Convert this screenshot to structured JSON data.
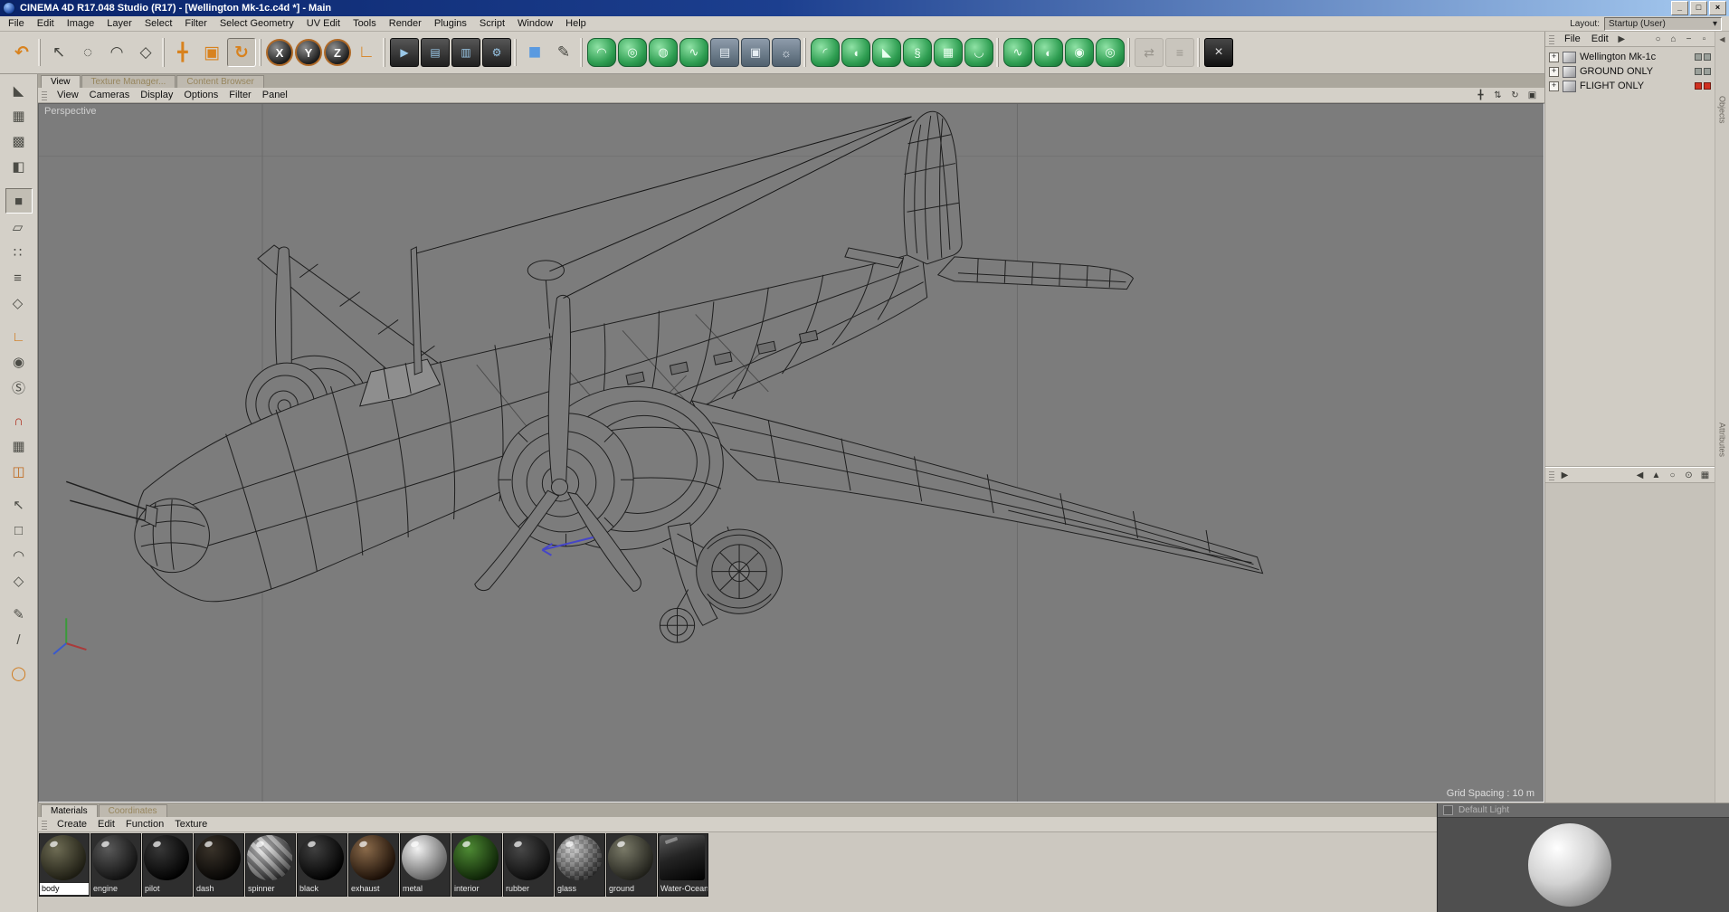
{
  "window": {
    "title": "CINEMA 4D R17.048 Studio (R17) - [Wellington Mk-1c.c4d *] - Main",
    "controls": [
      {
        "name": "minimize-button",
        "glyph": "_"
      },
      {
        "name": "maximize-button",
        "glyph": "□"
      },
      {
        "name": "close-button",
        "glyph": "×"
      }
    ]
  },
  "menubar": {
    "items": [
      "File",
      "Edit",
      "Image",
      "Layer",
      "Select",
      "Filter",
      "Select Geometry",
      "UV Edit",
      "Tools",
      "Render",
      "Plugins",
      "Script",
      "Window",
      "Help"
    ],
    "layout_label": "Layout:",
    "layout_value": "Startup (User)",
    "layout_arrow": "▾"
  },
  "toolbar": {
    "groups": [
      {
        "icons": [
          {
            "name": "undo-icon",
            "glyph": "↶",
            "kind": "orange"
          }
        ]
      },
      {
        "icons": [
          {
            "name": "selection-tool-icon",
            "glyph": "↖",
            "kind": "plain"
          },
          {
            "name": "live-selection-icon",
            "glyph": "◌",
            "kind": "plain"
          },
          {
            "name": "lasso-selection-icon",
            "glyph": "◠",
            "kind": "plain"
          },
          {
            "name": "polygon-selection-icon",
            "glyph": "◇",
            "kind": "plain"
          }
        ]
      },
      {
        "icons": [
          {
            "name": "move-tool-icon",
            "glyph": "╋",
            "kind": "orange"
          },
          {
            "name": "scale-tool-icon",
            "glyph": "▣",
            "kind": "orange"
          },
          {
            "name": "rotate-tool-icon",
            "glyph": "↻",
            "kind": "orange",
            "active": true
          }
        ]
      },
      {
        "icons": [
          {
            "name": "lock-x-axis-icon",
            "glyph": "X",
            "kind": "axis"
          },
          {
            "name": "lock-y-axis-icon",
            "glyph": "Y",
            "kind": "axis"
          },
          {
            "name": "lock-z-axis-icon",
            "glyph": "Z",
            "kind": "axis"
          },
          {
            "name": "coordinate-system-icon",
            "glyph": "∟",
            "kind": "orange"
          }
        ]
      },
      {
        "icons": [
          {
            "name": "render-view-icon",
            "glyph": "▶",
            "kind": "dark"
          },
          {
            "name": "render-picture-viewer-icon",
            "glyph": "▤",
            "kind": "dark"
          },
          {
            "name": "render-team-icon",
            "glyph": "▥",
            "kind": "dark"
          },
          {
            "name": "render-settings-icon",
            "glyph": "⚙",
            "kind": "dark"
          }
        ]
      },
      {
        "icons": [
          {
            "name": "add-primitive-cube-icon",
            "glyph": "■",
            "kind": "blue"
          },
          {
            "name": "spline-pen-icon",
            "glyph": "✎",
            "kind": "plain"
          }
        ]
      },
      {
        "icons": [
          {
            "name": "subdivision-surface-icon",
            "glyph": "◠",
            "kind": "green"
          },
          {
            "name": "extrude-icon",
            "glyph": "◎",
            "kind": "green"
          },
          {
            "name": "lathe-icon",
            "glyph": "◍",
            "kind": "green"
          },
          {
            "name": "sweep-icon",
            "glyph": "∿",
            "kind": "green"
          },
          {
            "name": "stage-icon",
            "glyph": "▤",
            "kind": "scene"
          },
          {
            "name": "camera-icon",
            "glyph": "▣",
            "kind": "scene"
          },
          {
            "name": "light-icon",
            "glyph": "☼",
            "kind": "scene"
          }
        ]
      },
      {
        "icons": [
          {
            "name": "bend-deformer-icon",
            "glyph": "◜",
            "kind": "green"
          },
          {
            "name": "bulge-deformer-icon",
            "glyph": "◖",
            "kind": "green"
          },
          {
            "name": "taper-deformer-icon",
            "glyph": "◣",
            "kind": "green"
          },
          {
            "name": "twist-deformer-icon",
            "glyph": "§",
            "kind": "green"
          },
          {
            "name": "ffd-deformer-icon",
            "glyph": "▦",
            "kind": "green"
          },
          {
            "name": "squash-deformer-icon",
            "glyph": "◡",
            "kind": "green"
          }
        ]
      },
      {
        "icons": [
          {
            "name": "spline-wrap-icon",
            "glyph": "∿",
            "kind": "green"
          },
          {
            "name": "morph-icon",
            "glyph": "◐",
            "kind": "green"
          },
          {
            "name": "jiggle-icon",
            "glyph": "◉",
            "kind": "green"
          },
          {
            "name": "collision-icon",
            "glyph": "◎",
            "kind": "green"
          }
        ]
      },
      {
        "icons": [
          {
            "name": "xref-icon",
            "glyph": "⇄",
            "kind": "disabled"
          },
          {
            "name": "merge-icon",
            "glyph": "≡",
            "kind": "disabled"
          }
        ]
      },
      {
        "icons": [
          {
            "name": "bodypaint-icon",
            "glyph": "×",
            "kind": "darkx"
          }
        ]
      }
    ]
  },
  "left_tools": {
    "groups": [
      {
        "icons": [
          {
            "name": "make-editable-icon",
            "glyph": "◣"
          },
          {
            "name": "model-mode-icon",
            "glyph": "▦"
          },
          {
            "name": "texture-mode-icon",
            "glyph": "▩"
          },
          {
            "name": "workplane-mode-icon",
            "glyph": "◧"
          }
        ]
      },
      {
        "icons": [
          {
            "name": "object-mode-icon",
            "glyph": "■",
            "active": true
          },
          {
            "name": "animation-mode-icon",
            "glyph": "▱"
          },
          {
            "name": "points-mode-icon",
            "glyph": "∷"
          },
          {
            "name": "edges-mode-icon",
            "glyph": "≡"
          },
          {
            "name": "polygons-mode-icon",
            "glyph": "◇"
          }
        ]
      },
      {
        "icons": [
          {
            "name": "axis-mode-icon",
            "glyph": "∟",
            "color": "#d07818"
          },
          {
            "name": "viewport-nav-icon",
            "glyph": "◉"
          },
          {
            "name": "snap-icon",
            "glyph": "Ⓢ"
          }
        ]
      },
      {
        "icons": [
          {
            "name": "magnet-icon",
            "glyph": "∩",
            "color": "#b03020"
          },
          {
            "name": "lock-workplane-icon",
            "glyph": "▦"
          },
          {
            "name": "interactive-workplane-icon",
            "glyph": "◫",
            "color": "#c06a20"
          }
        ]
      },
      {
        "icons": [
          {
            "name": "arrow-select-icon",
            "glyph": "↖"
          },
          {
            "name": "rect-select-icon",
            "glyph": "□"
          },
          {
            "name": "lasso-select-icon",
            "glyph": "◠"
          },
          {
            "name": "poly-select-icon",
            "glyph": "◇"
          }
        ]
      },
      {
        "icons": [
          {
            "name": "brush-icon",
            "glyph": "✎"
          },
          {
            "name": "eyedropper-icon",
            "glyph": "/"
          }
        ]
      },
      {
        "icons": [
          {
            "name": "rotate-ring-icon",
            "glyph": "◯",
            "color": "#d07818"
          }
        ]
      }
    ]
  },
  "viewport": {
    "tabs": [
      {
        "label": "View",
        "active": true
      },
      {
        "label": "Texture Manager...",
        "active": false
      },
      {
        "label": "Content Browser",
        "active": false
      }
    ],
    "menu": [
      "View",
      "Cameras",
      "Display",
      "Options",
      "Filter",
      "Panel"
    ],
    "nav_icons": [
      {
        "name": "pan-view-icon",
        "glyph": "╋"
      },
      {
        "name": "zoom-view-icon",
        "glyph": "⇅"
      },
      {
        "name": "rotate-view-icon",
        "glyph": "↻"
      },
      {
        "name": "toggle-layout-icon",
        "glyph": "▣"
      }
    ],
    "view_label": "Perspective",
    "grid_label": "Grid Spacing : 10 m"
  },
  "object_manager": {
    "menu": [
      "File",
      "Edit"
    ],
    "more_glyph": "▶",
    "expander": "+",
    "header_icons": [
      {
        "name": "search-icon",
        "glyph": "○"
      },
      {
        "name": "home-icon",
        "glyph": "⌂"
      },
      {
        "name": "minimize-panel-icon",
        "glyph": "−"
      },
      {
        "name": "float-panel-icon",
        "glyph": "▫"
      }
    ],
    "items": [
      {
        "label": "Wellington Mk-1c",
        "chips": [
          "#9aa09a",
          "#9aa09a"
        ]
      },
      {
        "label": "GROUND ONLY",
        "chips": [
          "#9aa09a",
          "#9aa09a"
        ]
      },
      {
        "label": "FLIGHT ONLY",
        "chips": [
          "#d03020",
          "#d03020"
        ]
      }
    ],
    "attr_bar_icons": [
      {
        "name": "history-back-icon",
        "glyph": "◀"
      },
      {
        "name": "history-up-icon",
        "glyph": "▲"
      },
      {
        "name": "attr-search-icon",
        "glyph": "○"
      },
      {
        "name": "attr-lock-icon",
        "glyph": "⊙"
      },
      {
        "name": "attr-grid-icon",
        "glyph": "▦"
      }
    ],
    "side_tabs": [
      "Objects",
      "Attributes"
    ],
    "strip_arrow": "◀"
  },
  "materials_panel": {
    "tabs": [
      {
        "label": "Materials",
        "active": true
      },
      {
        "label": "Coordinates",
        "active": false
      }
    ],
    "menu": [
      "Create",
      "Edit",
      "Function",
      "Texture"
    ],
    "materials": [
      {
        "name": "body",
        "c1": "#6e6c54",
        "c2": "#1d1c12",
        "selected": true
      },
      {
        "name": "engine",
        "c1": "#5a5a5a",
        "c2": "#101010"
      },
      {
        "name": "pilot",
        "c1": "#383838",
        "c2": "#000000"
      },
      {
        "name": "dash",
        "c1": "#3a332a",
        "c2": "#050403"
      },
      {
        "name": "spinner",
        "c1": "#d8d8d8",
        "c2": "#4a4a4a",
        "variant": "striped"
      },
      {
        "name": "black",
        "c1": "#404040",
        "c2": "#000000"
      },
      {
        "name": "exhaust",
        "c1": "#8a6a4a",
        "c2": "#1a0e06"
      },
      {
        "name": "metal",
        "c1": "#f2f2f2",
        "c2": "#606060"
      },
      {
        "name": "interior",
        "c1": "#4e8a34",
        "c2": "#0d2206"
      },
      {
        "name": "rubber",
        "c1": "#484848",
        "c2": "#0a0a0a"
      },
      {
        "name": "glass",
        "c1": "#b0b0b0",
        "c2": "#383838",
        "variant": "checker"
      },
      {
        "name": "ground",
        "c1": "#7a7a68",
        "c2": "#20201a"
      },
      {
        "name": "Water-Ocean",
        "c1": "#3a3a3a",
        "c2": "#000000",
        "variant": "cube"
      }
    ]
  },
  "light_panel": {
    "title": "Default Light"
  }
}
